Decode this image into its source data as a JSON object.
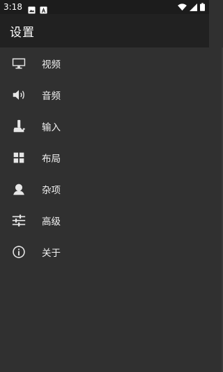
{
  "status_bar": {
    "time": "3:18",
    "left_icons": [
      "image-icon",
      "font-icon"
    ],
    "right_icons": [
      "wifi-icon",
      "signal-icon",
      "battery-icon"
    ]
  },
  "app_bar": {
    "title": "设置"
  },
  "menu": {
    "items": [
      {
        "label": "视频",
        "icon": "monitor-icon"
      },
      {
        "label": "音频",
        "icon": "speaker-icon"
      },
      {
        "label": "输入",
        "icon": "joystick-icon"
      },
      {
        "label": "布局",
        "icon": "grid-icon"
      },
      {
        "label": "杂项",
        "icon": "user-icon"
      },
      {
        "label": "高级",
        "icon": "sliders-icon"
      },
      {
        "label": "关于",
        "icon": "info-icon"
      }
    ]
  },
  "colors": {
    "status_bar_bg": "#1c1c1c",
    "app_bar_bg": "#212121",
    "drawer_bg": "#303030",
    "icon": "#e6e6e6",
    "text": "#f2f2f2"
  }
}
